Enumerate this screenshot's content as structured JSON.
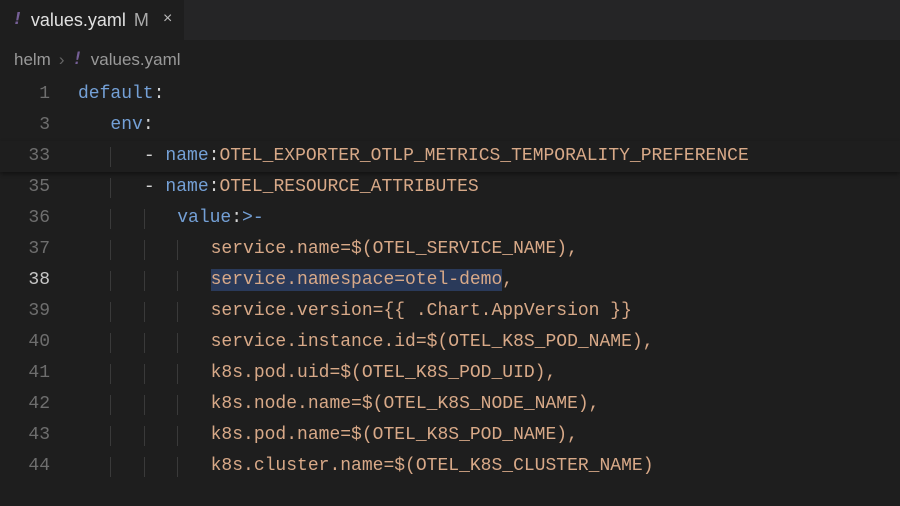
{
  "tab": {
    "icon_glyph": "!",
    "name": "values.yaml",
    "modified_mark": "M",
    "close_glyph": "×"
  },
  "breadcrumb": {
    "folder": "helm",
    "sep_glyph": "›",
    "icon_glyph": "!",
    "file": "values.yaml"
  },
  "lines": [
    {
      "num": "1",
      "content_type": "kv",
      "indent": 0,
      "key": "default",
      "value": ""
    },
    {
      "num": "3",
      "content_type": "kv",
      "indent": 1,
      "key": "env",
      "value": ""
    },
    {
      "num": "33",
      "content_type": "name",
      "indent": 2,
      "name": "OTEL_EXPORTER_OTLP_METRICS_TEMPORALITY_PREFERENCE",
      "sticky_last": true
    },
    {
      "num": "35",
      "content_type": "name",
      "indent": 2,
      "name": "OTEL_RESOURCE_ATTRIBUTES"
    },
    {
      "num": "36",
      "content_type": "value_fold",
      "indent": 3,
      "key": "value",
      "fold_op": ">-"
    },
    {
      "num": "37",
      "content_type": "str",
      "indent": 4,
      "text": "service.name=$(OTEL_SERVICE_NAME),"
    },
    {
      "num": "38",
      "content_type": "str_sel",
      "indent": 4,
      "text_sel": "service.namespace=otel-demo",
      "text_rest": ",",
      "current": true,
      "modified": true
    },
    {
      "num": "39",
      "content_type": "str",
      "indent": 4,
      "text": "service.version={{ .Chart.AppVersion }}"
    },
    {
      "num": "40",
      "content_type": "str",
      "indent": 4,
      "text": "service.instance.id=$(OTEL_K8S_POD_NAME),"
    },
    {
      "num": "41",
      "content_type": "str",
      "indent": 4,
      "text": "k8s.pod.uid=$(OTEL_K8S_POD_UID),"
    },
    {
      "num": "42",
      "content_type": "str",
      "indent": 4,
      "text": "k8s.node.name=$(OTEL_K8S_NODE_NAME),"
    },
    {
      "num": "43",
      "content_type": "str",
      "indent": 4,
      "text": "k8s.pod.name=$(OTEL_K8S_POD_NAME),"
    },
    {
      "num": "44",
      "content_type": "str",
      "indent": 4,
      "text": "k8s.cluster.name=$(OTEL_K8S_CLUSTER_NAME)"
    }
  ]
}
